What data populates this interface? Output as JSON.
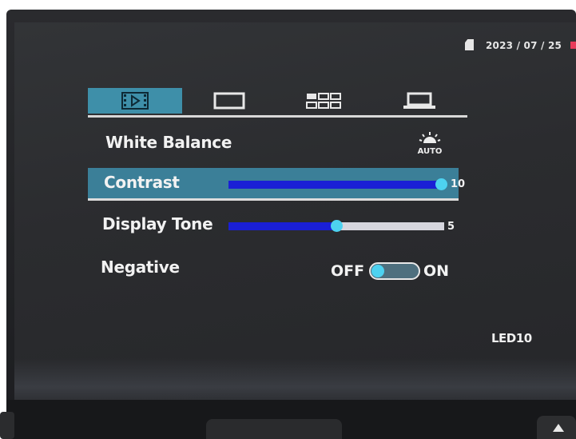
{
  "status_bar": {
    "date": "2023 / 07 / 25",
    "sd_card_icon": "sd-card-icon",
    "indicator_color": "#e83a5a"
  },
  "tabs": [
    {
      "icon": "playback-film-icon",
      "selected": true
    },
    {
      "icon": "single-view-icon",
      "selected": false
    },
    {
      "icon": "multi-view-grid-icon",
      "selected": false
    },
    {
      "icon": "laptop-setup-icon",
      "selected": false
    }
  ],
  "menu": {
    "white_balance": {
      "label": "White Balance",
      "value_icon": "wb-auto-icon",
      "value_text": "AUTO"
    },
    "contrast": {
      "label": "Contrast",
      "value": "10",
      "level": 1.0,
      "selected": true
    },
    "display_tone": {
      "label": "Display Tone",
      "value": "5",
      "level": 0.5
    },
    "negative": {
      "label": "Negative",
      "off_label": "OFF",
      "on_label": "ON",
      "state": "off"
    }
  },
  "model": "LED10",
  "colors": {
    "accent": "#3e8fa9",
    "slider_fill": "#1a1fd6",
    "knob": "#4dd2f0",
    "screen_bg": "#2e3033"
  }
}
